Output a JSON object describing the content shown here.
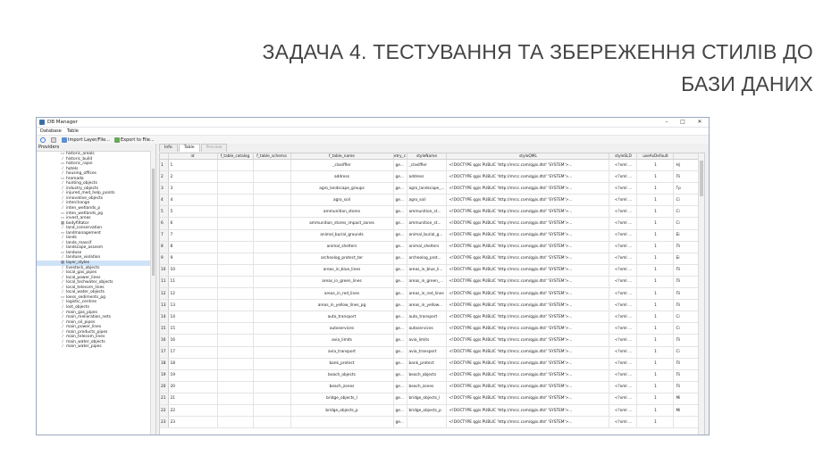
{
  "slide": {
    "title_line1": "ЗАДАЧА 4. ТЕСТУВАННЯ ТА ЗБЕРЕЖЕННЯ СТИЛІВ ДО",
    "title_line2": "БАЗИ ДАНИХ"
  },
  "window": {
    "title": "DB Manager",
    "minimize": "–",
    "maximize": "□",
    "close": "✕"
  },
  "menu": {
    "database": "Database",
    "table": "Table"
  },
  "toolbar": {
    "import_label": "Import Layer/File...",
    "export_label": "Export to File..."
  },
  "providers": {
    "header": "Providers",
    "items": [
      {
        "label": "historic_areals",
        "icon": "polygon-icon"
      },
      {
        "label": "historic_build",
        "icon": "line-icon"
      },
      {
        "label": "historic_rajon",
        "icon": "polygon-icon"
      },
      {
        "label": "hotels",
        "icon": "line-icon"
      },
      {
        "label": "housing_offices",
        "icon": "line-icon"
      },
      {
        "label": "hromada",
        "icon": "polygon-icon"
      },
      {
        "label": "hunting_objects",
        "icon": "line-icon"
      },
      {
        "label": "industry_objects",
        "icon": "line-icon"
      },
      {
        "label": "injured_med_help_points",
        "icon": "line-icon"
      },
      {
        "label": "innovative_objects",
        "icon": "line-icon"
      },
      {
        "label": "interchange",
        "icon": "line-icon"
      },
      {
        "label": "inten_wetlands_p",
        "icon": "line-icon"
      },
      {
        "label": "inten_wetlands_pg",
        "icon": "polygon-icon"
      },
      {
        "label": "invest_areas",
        "icon": "polygon-icon"
      },
      {
        "label": "bodyfiltator",
        "icon": "table-icon"
      },
      {
        "label": "land_conservation",
        "icon": "line-icon"
      },
      {
        "label": "landmanagement",
        "icon": "polygon-icon"
      },
      {
        "label": "lands",
        "icon": "line-icon"
      },
      {
        "label": "lands_massif",
        "icon": "line-icon"
      },
      {
        "label": "landscape_assesm",
        "icon": "line-icon"
      },
      {
        "label": "landuse",
        "icon": "polygon-icon"
      },
      {
        "label": "landuse_violation",
        "icon": "line-icon"
      },
      {
        "label": "layer_styles",
        "icon": "table-icon",
        "selected": true
      },
      {
        "label": "livestock_objects",
        "icon": "line-icon"
      },
      {
        "label": "local_gas_pipes",
        "icon": "line-icon"
      },
      {
        "label": "local_power_lines",
        "icon": "line-icon"
      },
      {
        "label": "local_techwater_objects",
        "icon": "line-icon"
      },
      {
        "label": "local_telecom_lines",
        "icon": "line-icon"
      },
      {
        "label": "local_water_objects",
        "icon": "line-icon"
      },
      {
        "label": "loess_sediments_pg",
        "icon": "polygon-icon"
      },
      {
        "label": "logistic_centres",
        "icon": "line-icon"
      },
      {
        "label": "lost_objects",
        "icon": "line-icon"
      },
      {
        "label": "main_gas_pipes",
        "icon": "line-icon"
      },
      {
        "label": "main_melioration_nets",
        "icon": "line-icon"
      },
      {
        "label": "main_oil_pipes",
        "icon": "line-icon"
      },
      {
        "label": "main_power_lines",
        "icon": "line-icon"
      },
      {
        "label": "main_products_pipes",
        "icon": "line-icon"
      },
      {
        "label": "main_telecom_lines",
        "icon": "line-icon"
      },
      {
        "label": "main_water_objects",
        "icon": "line-icon"
      },
      {
        "label": "main_water_pipes",
        "icon": "line-icon"
      }
    ]
  },
  "tabs": [
    {
      "label": "Info"
    },
    {
      "label": "Table",
      "active": true
    },
    {
      "label": "Preview",
      "disabled": true
    }
  ],
  "table": {
    "columns": [
      "id",
      "f_table_catalog",
      "f_table_schema",
      "f_table_name",
      "etry_c",
      "styleName",
      "styleQML",
      "styleSLD",
      "useAsDefault",
      ""
    ],
    "rows": [
      [
        "1",
        "1",
        "",
        "",
        "_clasiffier",
        "ge...",
        "_clasiffier",
        "<!DOCTYPE qgis PUBLIC 'http://mrcc.com/qgis.dtd' 'SYSTEM'>...",
        "<?xml ...",
        "1",
        "Hj"
      ],
      [
        "2",
        "2",
        "",
        "",
        "address",
        "ge...",
        "address",
        "<!DOCTYPE qgis PUBLIC 'http://mrcc.com/qgis.dtd' 'SYSTEM'>...",
        "<?xml ...",
        "1",
        "Пі"
      ],
      [
        "3",
        "3",
        "",
        "",
        "agro_landscape_groups",
        "ge...",
        "agro_landscape_...",
        "<!DOCTYPE qgis PUBLIC 'http://mrcc.com/qgis.dtd' 'SYSTEM'>...",
        "<?xml ...",
        "1",
        "Гр"
      ],
      [
        "4",
        "4",
        "",
        "",
        "agro_soil",
        "ge...",
        "agro_soil",
        "<!DOCTYPE qgis PUBLIC 'http://mrcc.com/qgis.dtd' 'SYSTEM'>...",
        "<?xml ...",
        "1",
        "Сі"
      ],
      [
        "5",
        "5",
        "",
        "",
        "ammunition_stores",
        "ge...",
        "ammunition_st...",
        "<!DOCTYPE qgis PUBLIC 'http://mrcc.com/qgis.dtd' 'SYSTEM'>...",
        "<?xml ...",
        "1",
        "Сі"
      ],
      [
        "6",
        "6",
        "",
        "",
        "ammunition_stores_impact_zones",
        "ge...",
        "ammunition_st...",
        "<!DOCTYPE qgis PUBLIC 'http://mrcc.com/qgis.dtd' 'SYSTEM'>...",
        "<?xml ...",
        "1",
        "Сі"
      ],
      [
        "7",
        "7",
        "",
        "",
        "animal_burial_grounds",
        "ge...",
        "animal_burial_g...",
        "<!DOCTYPE qgis PUBLIC 'http://mrcc.com/qgis.dtd' 'SYSTEM'>...",
        "<?xml ...",
        "1",
        "Бі"
      ],
      [
        "8",
        "8",
        "",
        "",
        "animal_shelters",
        "ge...",
        "animal_shelters",
        "<!DOCTYPE qgis PUBLIC 'http://mrcc.com/qgis.dtd' 'SYSTEM'>...",
        "<?xml ...",
        "1",
        "Пі"
      ],
      [
        "9",
        "9",
        "",
        "",
        "archeolog_protect_ter",
        "ge...",
        "archeolog_prot...",
        "<!DOCTYPE qgis PUBLIC 'http://mrcc.com/qgis.dtd' 'SYSTEM'>...",
        "<?xml ...",
        "1",
        "Бі"
      ],
      [
        "10",
        "10",
        "",
        "",
        "areas_in_blue_lines",
        "ge...",
        "areas_in_blue_li...",
        "<!DOCTYPE qgis PUBLIC 'http://mrcc.com/qgis.dtd' 'SYSTEM'>...",
        "<?xml ...",
        "1",
        "Пі"
      ],
      [
        "11",
        "11",
        "",
        "",
        "areas_in_green_lines",
        "ge...",
        "areas_in_green_...",
        "<!DOCTYPE qgis PUBLIC 'http://mrcc.com/qgis.dtd' 'SYSTEM'>...",
        "<?xml ...",
        "1",
        "Пі"
      ],
      [
        "12",
        "12",
        "",
        "",
        "areas_in_red_lines",
        "ge...",
        "areas_in_red_lines",
        "<!DOCTYPE qgis PUBLIC 'http://mrcc.com/qgis.dtd' 'SYSTEM'>...",
        "<?xml ...",
        "1",
        "Пі"
      ],
      [
        "13",
        "13",
        "",
        "",
        "areas_in_yellow_lines_pg",
        "ge...",
        "areas_in_yellow...",
        "<!DOCTYPE qgis PUBLIC 'http://mrcc.com/qgis.dtd' 'SYSTEM'>...",
        "<?xml ...",
        "1",
        "Пі"
      ],
      [
        "14",
        "14",
        "",
        "",
        "auto_transport",
        "ge...",
        "auto_transport",
        "<!DOCTYPE qgis PUBLIC 'http://mrcc.com/qgis.dtd' 'SYSTEM'>...",
        "<?xml ...",
        "1",
        "Сі"
      ],
      [
        "15",
        "15",
        "",
        "",
        "autoservices",
        "ge...",
        "autoservices",
        "<!DOCTYPE qgis PUBLIC 'http://mrcc.com/qgis.dtd' 'SYSTEM'>...",
        "<?xml ...",
        "1",
        "Сі"
      ],
      [
        "16",
        "16",
        "",
        "",
        "avia_limits",
        "ge...",
        "avia_limits",
        "<!DOCTYPE qgis PUBLIC 'http://mrcc.com/qgis.dtd' 'SYSTEM'>...",
        "<?xml ...",
        "1",
        "Пі"
      ],
      [
        "17",
        "17",
        "",
        "",
        "avia_transport",
        "ge...",
        "avia_transport",
        "<!DOCTYPE qgis PUBLIC 'http://mrcc.com/qgis.dtd' 'SYSTEM'>...",
        "<?xml ...",
        "1",
        "Сі"
      ],
      [
        "18",
        "18",
        "",
        "",
        "bank_protect",
        "ge...",
        "bank_protect",
        "<!DOCTYPE qgis PUBLIC 'http://mrcc.com/qgis.dtd' 'SYSTEM'>...",
        "<?xml ...",
        "1",
        "Пі"
      ],
      [
        "19",
        "19",
        "",
        "",
        "beach_objects",
        "ge...",
        "beach_objects",
        "<!DOCTYPE qgis PUBLIC 'http://mrcc.com/qgis.dtd' 'SYSTEM'>...",
        "<?xml ...",
        "1",
        "Пі"
      ],
      [
        "20",
        "20",
        "",
        "",
        "beach_zones",
        "ge...",
        "beach_zones",
        "<!DOCTYPE qgis PUBLIC 'http://mrcc.com/qgis.dtd' 'SYSTEM'>...",
        "<?xml ...",
        "1",
        "Пі"
      ],
      [
        "21",
        "21",
        "",
        "",
        "bridge_objects_l",
        "ge...",
        "bridge_objects_l",
        "<!DOCTYPE qgis PUBLIC 'http://mrcc.com/qgis.dtd' 'SYSTEM'>...",
        "<?xml ...",
        "1",
        "Мі"
      ],
      [
        "22",
        "22",
        "",
        "",
        "bridge_objects_p",
        "ge...",
        "bridge_objects_p",
        "<!DOCTYPE qgis PUBLIC 'http://mrcc.com/qgis.dtd' 'SYSTEM'>...",
        "<?xml ...",
        "1",
        "Мі"
      ],
      [
        "23",
        "23",
        "",
        "",
        "",
        "ge...",
        "",
        "<!DOCTYPE qgis PUBLIC 'http://mrcc.com/qgis.dtd' 'SYSTEM'>...",
        "<?xml ...",
        "1",
        ""
      ]
    ]
  }
}
